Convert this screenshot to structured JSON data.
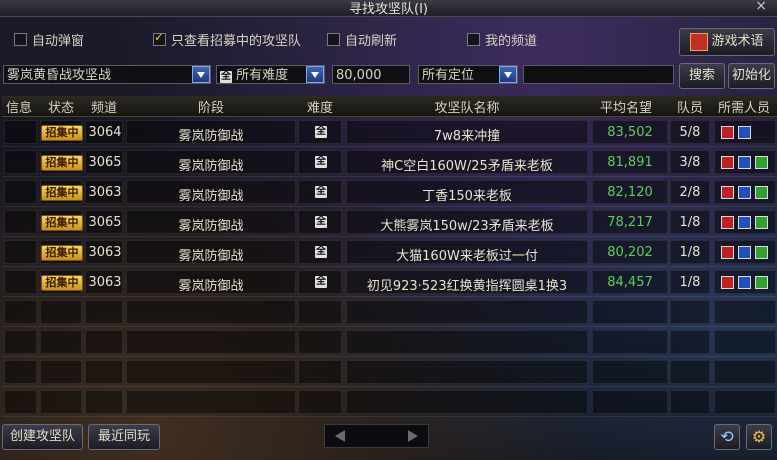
{
  "window": {
    "title": "寻找攻坚队(I)",
    "close": "×"
  },
  "options": [
    {
      "label": "自动弹窗",
      "checked": false
    },
    {
      "label": "只查看招募中的攻坚队",
      "checked": true
    },
    {
      "label": "自动刷新",
      "checked": false
    },
    {
      "label": "我的频道",
      "checked": false
    }
  ],
  "glossary_button": "游戏术语",
  "filters": {
    "raid": "雾岚黄昏战攻坚战",
    "difficulty_icon": "全",
    "difficulty": "所有难度",
    "fame": "80,000",
    "position": "所有定位",
    "keyword": ""
  },
  "search_button": "搜索",
  "reset_button": "初始化",
  "table": {
    "headers": [
      "信息",
      "状态",
      "频道",
      "阶段",
      "难度",
      "攻坚队名称",
      "平均名望",
      "队员",
      "所需人员"
    ],
    "rows": [
      {
        "status": "招集中",
        "channel": "3064",
        "stage": "雾岚防御战",
        "difficulty": "全",
        "name": "7w8来冲撞",
        "fame": "83,502",
        "members": "5/8",
        "need": [
          "red",
          "blue"
        ]
      },
      {
        "status": "招集中",
        "channel": "3065",
        "stage": "雾岚防御战",
        "difficulty": "全",
        "name": "神C空白160W/25矛盾来老板",
        "fame": "81,891",
        "members": "3/8",
        "need": [
          "red",
          "blue",
          "green"
        ]
      },
      {
        "status": "招集中",
        "channel": "3063",
        "stage": "雾岚防御战",
        "difficulty": "全",
        "name": "丁香150来老板",
        "fame": "82,120",
        "members": "2/8",
        "need": [
          "red",
          "blue",
          "green"
        ]
      },
      {
        "status": "招集中",
        "channel": "3065",
        "stage": "雾岚防御战",
        "difficulty": "全",
        "name": "大熊雾岚150w/23矛盾来老板",
        "fame": "78,217",
        "members": "1/8",
        "need": [
          "red",
          "blue",
          "green"
        ]
      },
      {
        "status": "招集中",
        "channel": "3063",
        "stage": "雾岚防御战",
        "difficulty": "全",
        "name": "大猫160W来老板过一付",
        "fame": "80,202",
        "members": "1/8",
        "need": [
          "red",
          "blue",
          "green"
        ]
      },
      {
        "status": "招集中",
        "channel": "3063",
        "stage": "雾岚防御战",
        "difficulty": "全",
        "name": "初见923·523红换黄指挥圆桌1换3",
        "fame": "84,457",
        "members": "1/8",
        "need": [
          "red",
          "blue",
          "green"
        ]
      }
    ]
  },
  "footer": {
    "create": "创建攻坚队",
    "recent": "最近同玩"
  },
  "icons": {
    "refresh": "refresh-icon",
    "settings": "gear-icon",
    "prev": "prev-page-arrow",
    "next": "next-page-arrow",
    "book": "book-icon"
  }
}
